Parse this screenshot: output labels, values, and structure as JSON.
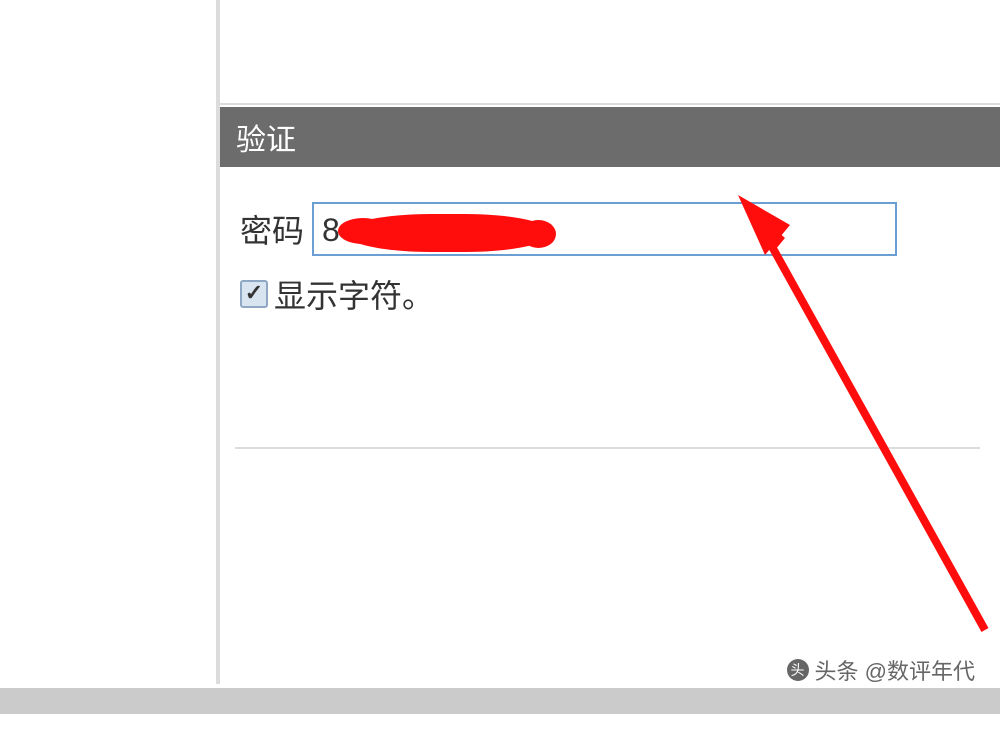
{
  "section": {
    "title": "验证"
  },
  "form": {
    "password_label": "密码",
    "password_visible_char": "8",
    "show_chars_label": "显示字符。",
    "show_chars_checked": true
  },
  "watermark": {
    "text": "头条 @数评年代"
  },
  "annotation": {
    "arrow_color": "#ff0d0d"
  }
}
